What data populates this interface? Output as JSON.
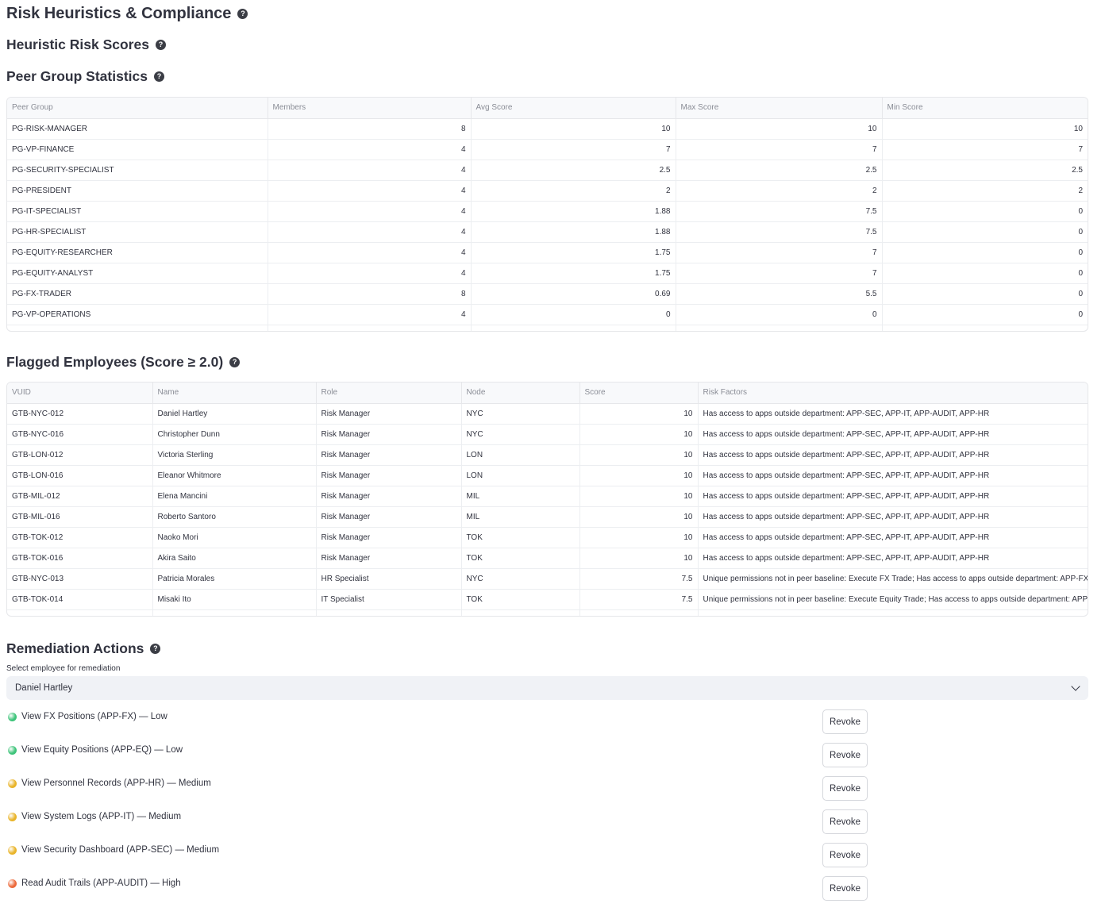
{
  "page": {
    "title": "Risk Heuristics & Compliance",
    "help_glyph": "?"
  },
  "sections": {
    "heuristic": "Heuristic Risk Scores",
    "peer": "Peer Group Statistics",
    "flagged": "Flagged Employees (Score ≥ 2.0)",
    "remediation": "Remediation Actions"
  },
  "peer_table": {
    "columns": [
      "Peer Group",
      "Members",
      "Avg Score",
      "Max Score",
      "Min Score"
    ],
    "rows": [
      [
        "PG-RISK-MANAGER",
        "8",
        "10",
        "10",
        "10"
      ],
      [
        "PG-VP-FINANCE",
        "4",
        "7",
        "7",
        "7"
      ],
      [
        "PG-SECURITY-SPECIALIST",
        "4",
        "2.5",
        "2.5",
        "2.5"
      ],
      [
        "PG-PRESIDENT",
        "4",
        "2",
        "2",
        "2"
      ],
      [
        "PG-IT-SPECIALIST",
        "4",
        "1.88",
        "7.5",
        "0"
      ],
      [
        "PG-HR-SPECIALIST",
        "4",
        "1.88",
        "7.5",
        "0"
      ],
      [
        "PG-EQUITY-RESEARCHER",
        "4",
        "1.75",
        "7",
        "0"
      ],
      [
        "PG-EQUITY-ANALYST",
        "4",
        "1.75",
        "7",
        "0"
      ],
      [
        "PG-FX-TRADER",
        "8",
        "0.69",
        "5.5",
        "0"
      ],
      [
        "PG-VP-OPERATIONS",
        "4",
        "0",
        "0",
        "0"
      ]
    ]
  },
  "flagged_table": {
    "columns": [
      "VUID",
      "Name",
      "Role",
      "Node",
      "Score",
      "Risk Factors"
    ],
    "rows": [
      [
        "GTB-NYC-012",
        "Daniel Hartley",
        "Risk Manager",
        "NYC",
        "10",
        "Has access to apps outside department: APP-SEC, APP-IT, APP-AUDIT, APP-HR"
      ],
      [
        "GTB-NYC-016",
        "Christopher Dunn",
        "Risk Manager",
        "NYC",
        "10",
        "Has access to apps outside department: APP-SEC, APP-IT, APP-AUDIT, APP-HR"
      ],
      [
        "GTB-LON-012",
        "Victoria Sterling",
        "Risk Manager",
        "LON",
        "10",
        "Has access to apps outside department: APP-SEC, APP-IT, APP-AUDIT, APP-HR"
      ],
      [
        "GTB-LON-016",
        "Eleanor Whitmore",
        "Risk Manager",
        "LON",
        "10",
        "Has access to apps outside department: APP-SEC, APP-IT, APP-AUDIT, APP-HR"
      ],
      [
        "GTB-MIL-012",
        "Elena Mancini",
        "Risk Manager",
        "MIL",
        "10",
        "Has access to apps outside department: APP-SEC, APP-IT, APP-AUDIT, APP-HR"
      ],
      [
        "GTB-MIL-016",
        "Roberto Santoro",
        "Risk Manager",
        "MIL",
        "10",
        "Has access to apps outside department: APP-SEC, APP-IT, APP-AUDIT, APP-HR"
      ],
      [
        "GTB-TOK-012",
        "Naoko Mori",
        "Risk Manager",
        "TOK",
        "10",
        "Has access to apps outside department: APP-SEC, APP-IT, APP-AUDIT, APP-HR"
      ],
      [
        "GTB-TOK-016",
        "Akira Saito",
        "Risk Manager",
        "TOK",
        "10",
        "Has access to apps outside department: APP-SEC, APP-IT, APP-AUDIT, APP-HR"
      ],
      [
        "GTB-NYC-013",
        "Patricia Morales",
        "HR Specialist",
        "NYC",
        "7.5",
        "Unique permissions not in peer baseline: Execute FX Trade; Has access to apps outside department: APP-FX; Has"
      ],
      [
        "GTB-TOK-014",
        "Misaki Ito",
        "IT Specialist",
        "TOK",
        "7.5",
        "Unique permissions not in peer baseline: Execute Equity Trade; Has access to apps outside department: APP-EQ"
      ]
    ]
  },
  "remediation": {
    "select_label": "Select employee for remediation",
    "selected_employee": "Daniel Hartley",
    "revoke_label": "Revoke",
    "permissions": [
      {
        "text": "View FX Positions (APP-FX) — Low",
        "level": "low",
        "color": "#3ec47a"
      },
      {
        "text": "View Equity Positions (APP-EQ) — Low",
        "level": "low",
        "color": "#3ec47a"
      },
      {
        "text": "View Personnel Records (APP-HR) — Medium",
        "level": "medium",
        "color": "#e9b42a"
      },
      {
        "text": "View System Logs (APP-IT) — Medium",
        "level": "medium",
        "color": "#e9b42a"
      },
      {
        "text": "View Security Dashboard (APP-SEC) — Medium",
        "level": "medium",
        "color": "#e9b42a"
      },
      {
        "text": "Read Audit Trails (APP-AUDIT) — High",
        "level": "high",
        "color": "#ec6a3c"
      }
    ]
  }
}
